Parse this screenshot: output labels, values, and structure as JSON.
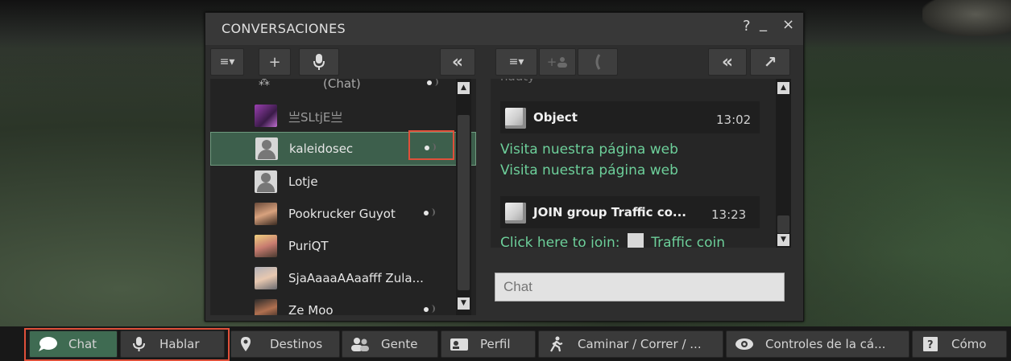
{
  "window": {
    "title": "CONVERSACIONES",
    "help": "?",
    "minimize": "_",
    "close": "×"
  },
  "left_toolbar": {
    "options": "≡▾",
    "add": "+",
    "voice": "mic",
    "collapse": "«"
  },
  "right_toolbar": {
    "options": "≡▾",
    "add_friend": "+",
    "call": "phone",
    "collapse": "«",
    "expand": "↗"
  },
  "conversations": {
    "cut_top_label": "(Chat)",
    "items": [
      {
        "name": "亗SLtjE亗",
        "avatar": "photo"
      },
      {
        "name": "kaleidosec",
        "avatar": "generic",
        "selected": true,
        "speaking": true
      },
      {
        "name": "Lotje",
        "avatar": "generic"
      },
      {
        "name": "Pookrucker Guyot",
        "avatar": "photo",
        "speaking": true
      },
      {
        "name": "PuriQT",
        "avatar": "photo"
      },
      {
        "name": "SjaAaaaAAaafff Zula...",
        "avatar": "photo"
      },
      {
        "name": "Ze Moo",
        "avatar": "photo",
        "speaking": true
      }
    ]
  },
  "chat": {
    "cut_top_text": "nauty",
    "messages": [
      {
        "sender": "Object",
        "time": "13:02",
        "lines": [
          "Visita nuestra página web",
          "Visita nuestra página web"
        ]
      },
      {
        "sender": "JOIN group Traffic co...",
        "time": "13:23",
        "prefix": "Click here to join:",
        "link": "Traffic coin"
      }
    ],
    "input_placeholder": "Chat"
  },
  "bottom_toolbar": [
    {
      "label": "Chat",
      "icon": "speech-bubble-icon",
      "active": true
    },
    {
      "label": "Hablar",
      "icon": "microphone-icon"
    },
    {
      "label": "Destinos",
      "icon": "map-pin-icon"
    },
    {
      "label": "Gente",
      "icon": "people-icon"
    },
    {
      "label": "Perfil",
      "icon": "id-card-icon"
    },
    {
      "label": "Caminar / Correr / ...",
      "icon": "walking-icon"
    },
    {
      "label": "Controles de la cá...",
      "icon": "eye-icon"
    },
    {
      "label": "Cómo",
      "icon": "help-book-icon"
    }
  ],
  "colors": {
    "accent_green": "#3d5f4c",
    "message_text": "#6dcf9a",
    "highlight_red": "#e0503a"
  }
}
